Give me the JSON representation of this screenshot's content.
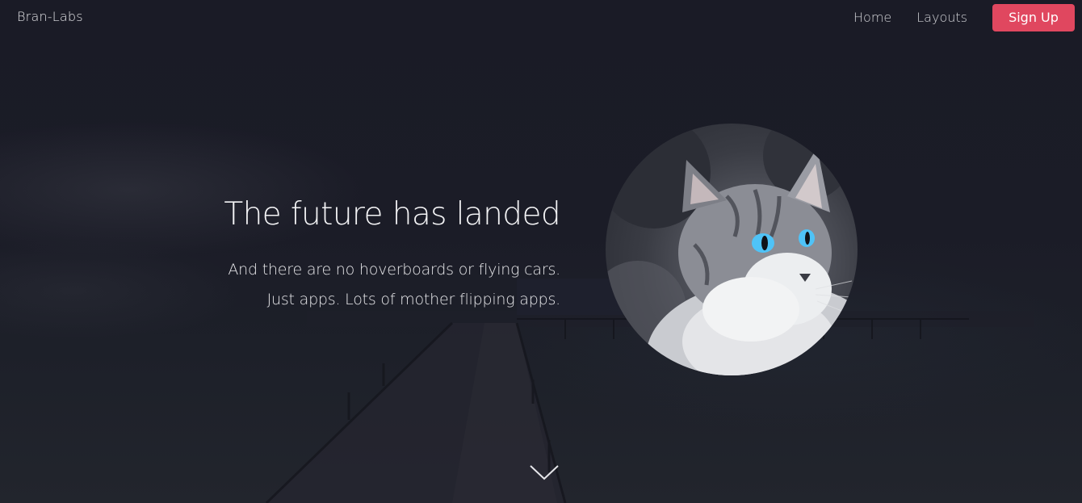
{
  "nav": {
    "brand": "Bran-Labs",
    "links": [
      {
        "label": "Home"
      },
      {
        "label": "Layouts"
      }
    ],
    "signup_label": "Sign Up"
  },
  "hero": {
    "title": "The future has landed",
    "subtitle_line1": "And there are no hoverboards or flying cars.",
    "subtitle_line2": "Just apps. Lots of mother flipping apps.",
    "image_icon": "cat-photo",
    "scroll_icon": "chevron-down-icon"
  },
  "colors": {
    "accent": "#e0475f",
    "background": "#1b1c26",
    "text": "#f3f3f5",
    "cat_eye": "#4fc3f7"
  }
}
